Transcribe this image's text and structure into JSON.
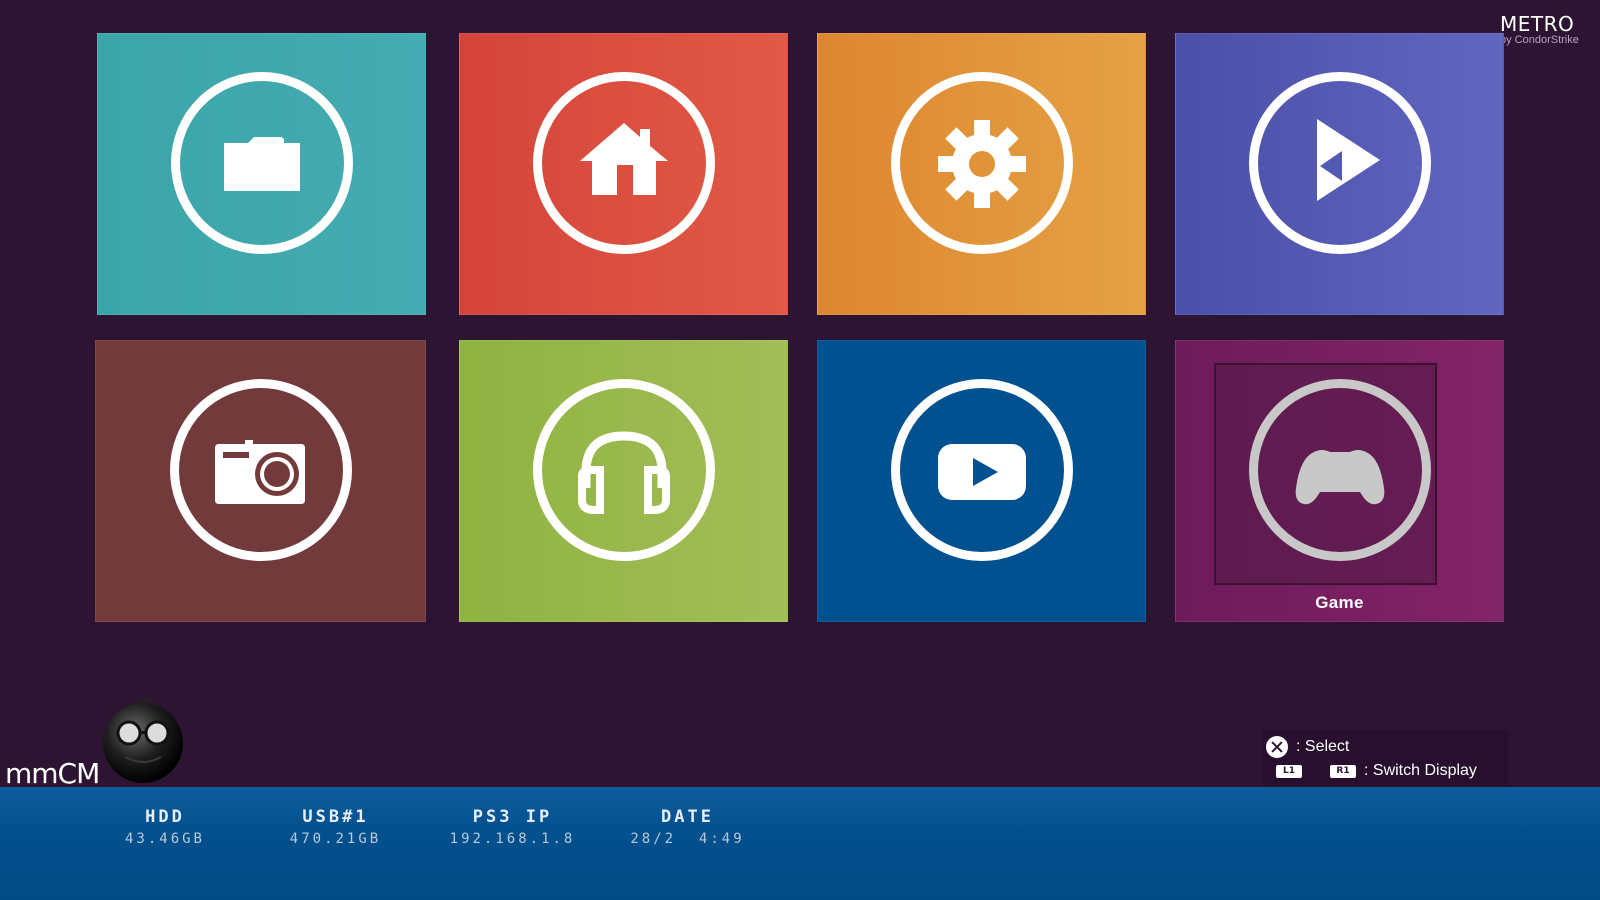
{
  "brand": {
    "title": "METRO",
    "subtitle": "by CondorStrike"
  },
  "tiles": [
    {
      "id": "files",
      "icon": "folder-icon",
      "color": "#3ca5a8"
    },
    {
      "id": "home",
      "icon": "home-icon",
      "color": "#d5443a"
    },
    {
      "id": "settings",
      "icon": "gear-icon",
      "color": "#de8631"
    },
    {
      "id": "video",
      "icon": "play-triangle-icon",
      "color": "#4b4fa8"
    },
    {
      "id": "photo",
      "icon": "camera-icon",
      "color": "#723a3b"
    },
    {
      "id": "music",
      "icon": "headphones-icon",
      "color": "#8fb341"
    },
    {
      "id": "youtube",
      "icon": "youtube-icon",
      "color": "#01508f"
    },
    {
      "id": "game",
      "icon": "gamepad-icon",
      "color": "#6e1b5a",
      "label": "Game",
      "selected": true
    }
  ],
  "app_name": "mmCM",
  "help": {
    "select_label": ": Select",
    "l1": "L1",
    "r1": "R1",
    "switch_label": ": Switch Display"
  },
  "status": {
    "hdd_label": "HDD",
    "hdd_value": "43.46GB",
    "usb_label": "USB#1",
    "usb_value": "470.21GB",
    "ip_label": "PS3 IP",
    "ip_value": "192.168.1.8",
    "date_label": "DATE",
    "date_value": "28/2  4:49"
  }
}
